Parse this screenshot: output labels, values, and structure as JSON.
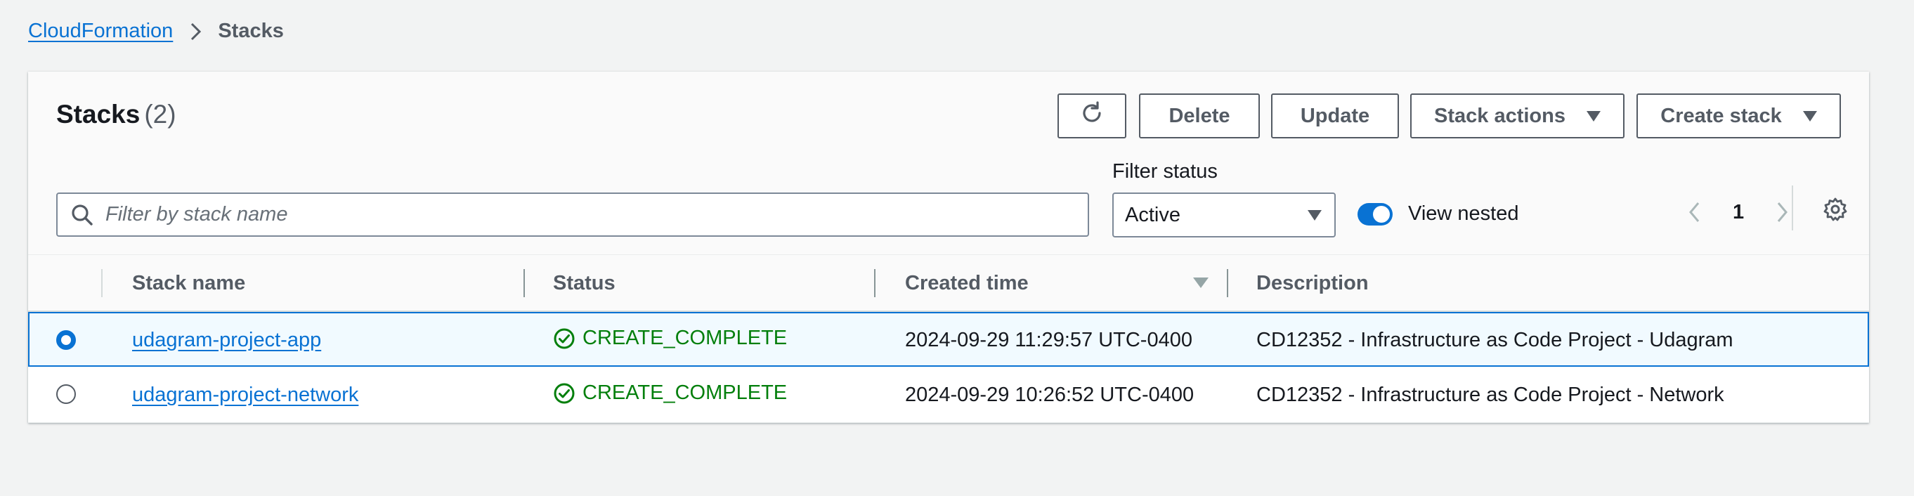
{
  "breadcrumb": {
    "root": "CloudFormation",
    "current": "Stacks"
  },
  "header": {
    "title": "Stacks",
    "count": "(2)"
  },
  "toolbar": {
    "refresh_icon": "refresh-icon",
    "delete_label": "Delete",
    "update_label": "Update",
    "stack_actions_label": "Stack actions",
    "create_stack_label": "Create stack"
  },
  "filters": {
    "search_placeholder": "Filter by stack name",
    "search_value": "",
    "status_label": "Filter status",
    "status_value": "Active",
    "view_nested_label": "View nested",
    "view_nested_on": true
  },
  "pagination": {
    "page": "1"
  },
  "table": {
    "columns": [
      "Stack name",
      "Status",
      "Created time",
      "Description"
    ],
    "sorted_column": "Created time",
    "rows": [
      {
        "name": "udagram-project-app",
        "status": "CREATE_COMPLETE",
        "created": "2024-09-29 11:29:57 UTC-0400",
        "description": "CD12352 - Infrastructure as Code Project - Udagram",
        "selected": true
      },
      {
        "name": "udagram-project-network",
        "status": "CREATE_COMPLETE",
        "created": "2024-09-29 10:26:52 UTC-0400",
        "description": "CD12352 - Infrastructure as Code Project - Network",
        "selected": false
      }
    ]
  },
  "colors": {
    "link": "#0972d3",
    "success": "#037f0c",
    "button_border": "#545b64"
  }
}
